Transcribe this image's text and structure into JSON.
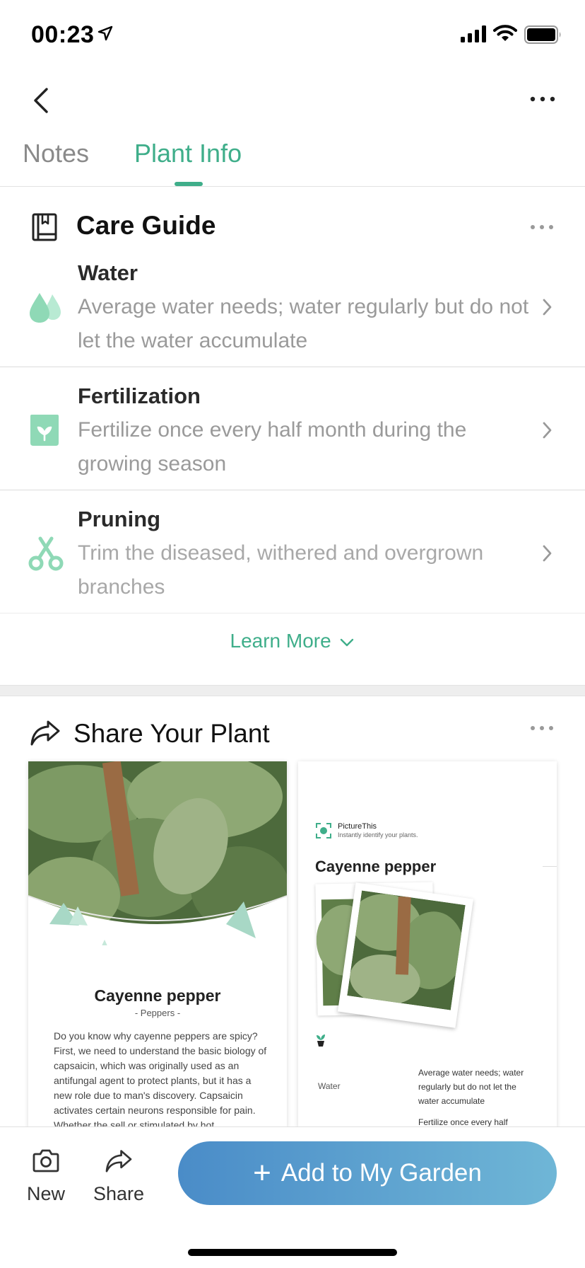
{
  "status_bar": {
    "time": "00:23"
  },
  "tabs": [
    {
      "label": "Notes",
      "active": false
    },
    {
      "label": "Plant Info",
      "active": true
    }
  ],
  "care_guide": {
    "title": "Care Guide",
    "items": [
      {
        "icon": "water-drops-icon",
        "title": "Water",
        "description": "Average water needs; water regularly but do not let the water accumulate"
      },
      {
        "icon": "fertilizer-bag-icon",
        "title": "Fertilization",
        "description": "Fertilize once every half month during the growing season"
      },
      {
        "icon": "scissors-icon",
        "title": "Pruning",
        "description": "Trim the diseased, withered and overgrown branches"
      }
    ],
    "learn_more": "Learn More"
  },
  "share_section": {
    "title": "Share Your Plant",
    "card1": {
      "plant_name": "Cayenne pepper",
      "subtitle": "- Peppers -",
      "body": "Do you know why cayenne peppers are spicy? First, we need to understand the basic biology of capsaicin, which was originally used as an antifungal agent to protect plants, but it has a new role due to man's discovery. Capsaicin activates certain neurons responsible for pain. Whether the sell or stimulated by hot..."
    },
    "card2": {
      "brand": "PictureThis",
      "tagline": "Instantly identify your plants.",
      "plant_name": "Cayenne pepper",
      "water_label": "Water",
      "water_text": "Average water needs; water regularly but do not let the water accumulate",
      "fert_text": "Fertilize once every half"
    }
  },
  "bottom_bar": {
    "new_label": "New",
    "share_label": "Share",
    "add_button": "Add to My Garden"
  },
  "colors": {
    "accent": "#3fae8a",
    "icon_green": "#8fd9b6",
    "button_gradient_start": "#4a8cc8",
    "button_gradient_end": "#6fb6d6"
  }
}
